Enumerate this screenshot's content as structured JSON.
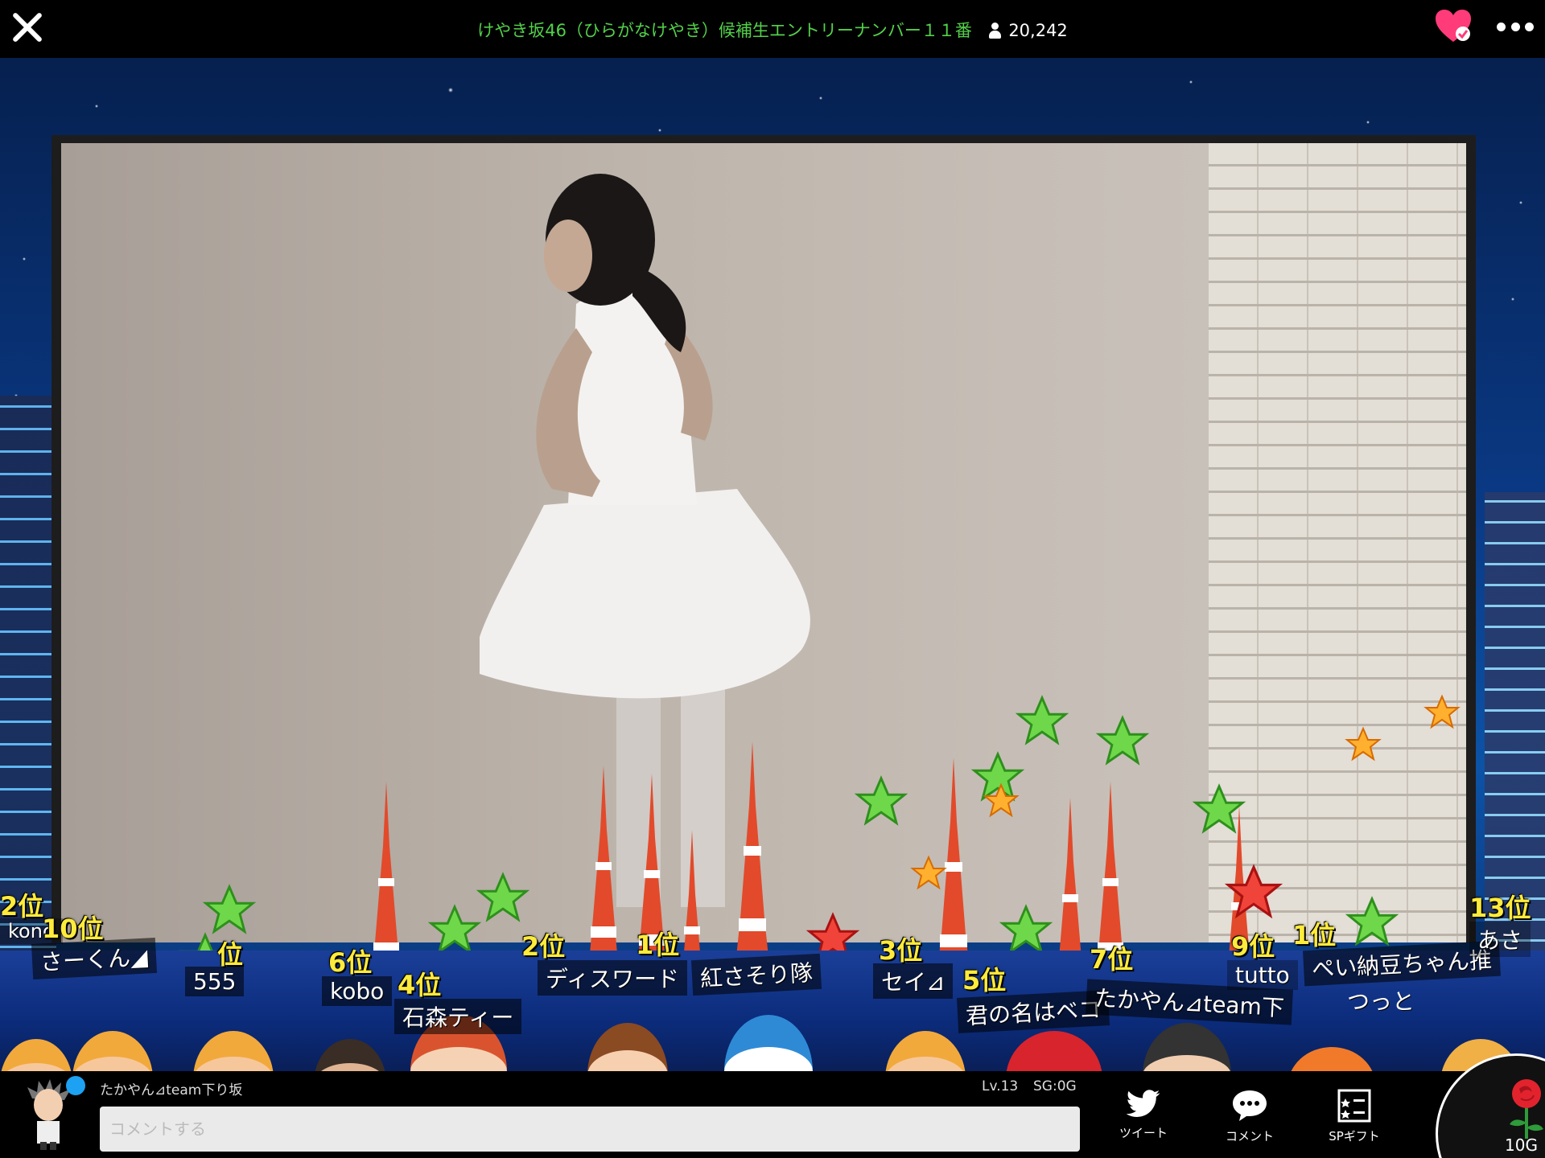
{
  "header": {
    "title": "けやき坂46（ひらがなけやき）候補生エントリーナンバー１１番",
    "viewer_count": "20,242"
  },
  "ranks": [
    {
      "rank": "2位",
      "name": "kono"
    },
    {
      "rank": "10位",
      "name": "さーくん◢"
    },
    {
      "rank": "位",
      "name": "555"
    },
    {
      "rank": "6位",
      "name": "kobo"
    },
    {
      "rank": "4位",
      "name": "石森ティー"
    },
    {
      "rank": "2位",
      "name": "ディスワード"
    },
    {
      "rank": "1位",
      "name": "紅さそり隊"
    },
    {
      "rank": "3位",
      "name": "セイ⊿"
    },
    {
      "rank": "5位",
      "name": "君の名はベコ"
    },
    {
      "rank": "7位",
      "name": "たかやん⊿team下"
    },
    {
      "rank": "9位",
      "name": "tutto"
    },
    {
      "rank": "1位",
      "name": "ぺい納豆ちゃん推"
    },
    {
      "rank": "13位",
      "name": "あさ"
    },
    {
      "rank": "",
      "name": "つっと"
    }
  ],
  "bottom": {
    "username": "たかやん⊿team下り坂",
    "level": "Lv.13",
    "sg": "SG:0G",
    "comment_placeholder": "コメントする",
    "tweet_label": "ツイート",
    "comment_label": "コメント",
    "spgift_label": "SPギフト",
    "gift_price": "10G"
  },
  "colors": {
    "title_green": "#53d04a",
    "heart_pink": "#ff3b7a",
    "rank_yellow": "#ffeb3b",
    "twitter_blue": "#1da1f2"
  },
  "icons": {
    "close": "close-icon",
    "favorite": "heart-check-icon",
    "more": "more-dots-icon",
    "tweet": "twitter-bird-icon",
    "comment": "speech-bubble-icon",
    "spgift": "gift-list-icon",
    "rose": "rose-icon"
  }
}
